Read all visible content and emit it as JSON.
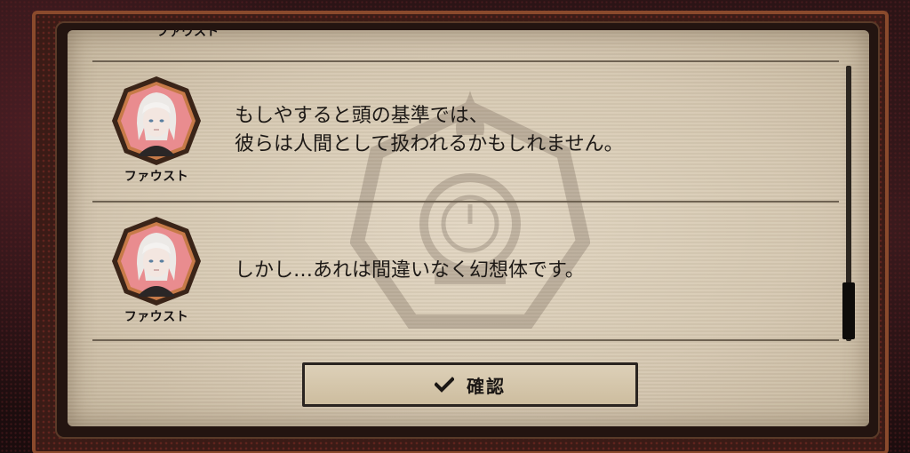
{
  "dialog": {
    "top_partial_speaker": "ファウスト",
    "entries": [
      {
        "speaker": "ファウスト",
        "text": "もしやすると頭の基準では、\n彼らは人間として扱われるかもしれません。",
        "avatar": "faust-portrait"
      },
      {
        "speaker": "ファウスト",
        "text": "しかし…あれは間違いなく幻想体です。",
        "avatar": "faust-portrait"
      }
    ],
    "confirm_label": "確認",
    "confirm_icon": "checkmark-icon"
  },
  "colors": {
    "frame_copper": "#8a4a2c",
    "paper": "#d5c7b0",
    "avatar_fill": "#e98c8f",
    "avatar_border": "#3a2418"
  }
}
